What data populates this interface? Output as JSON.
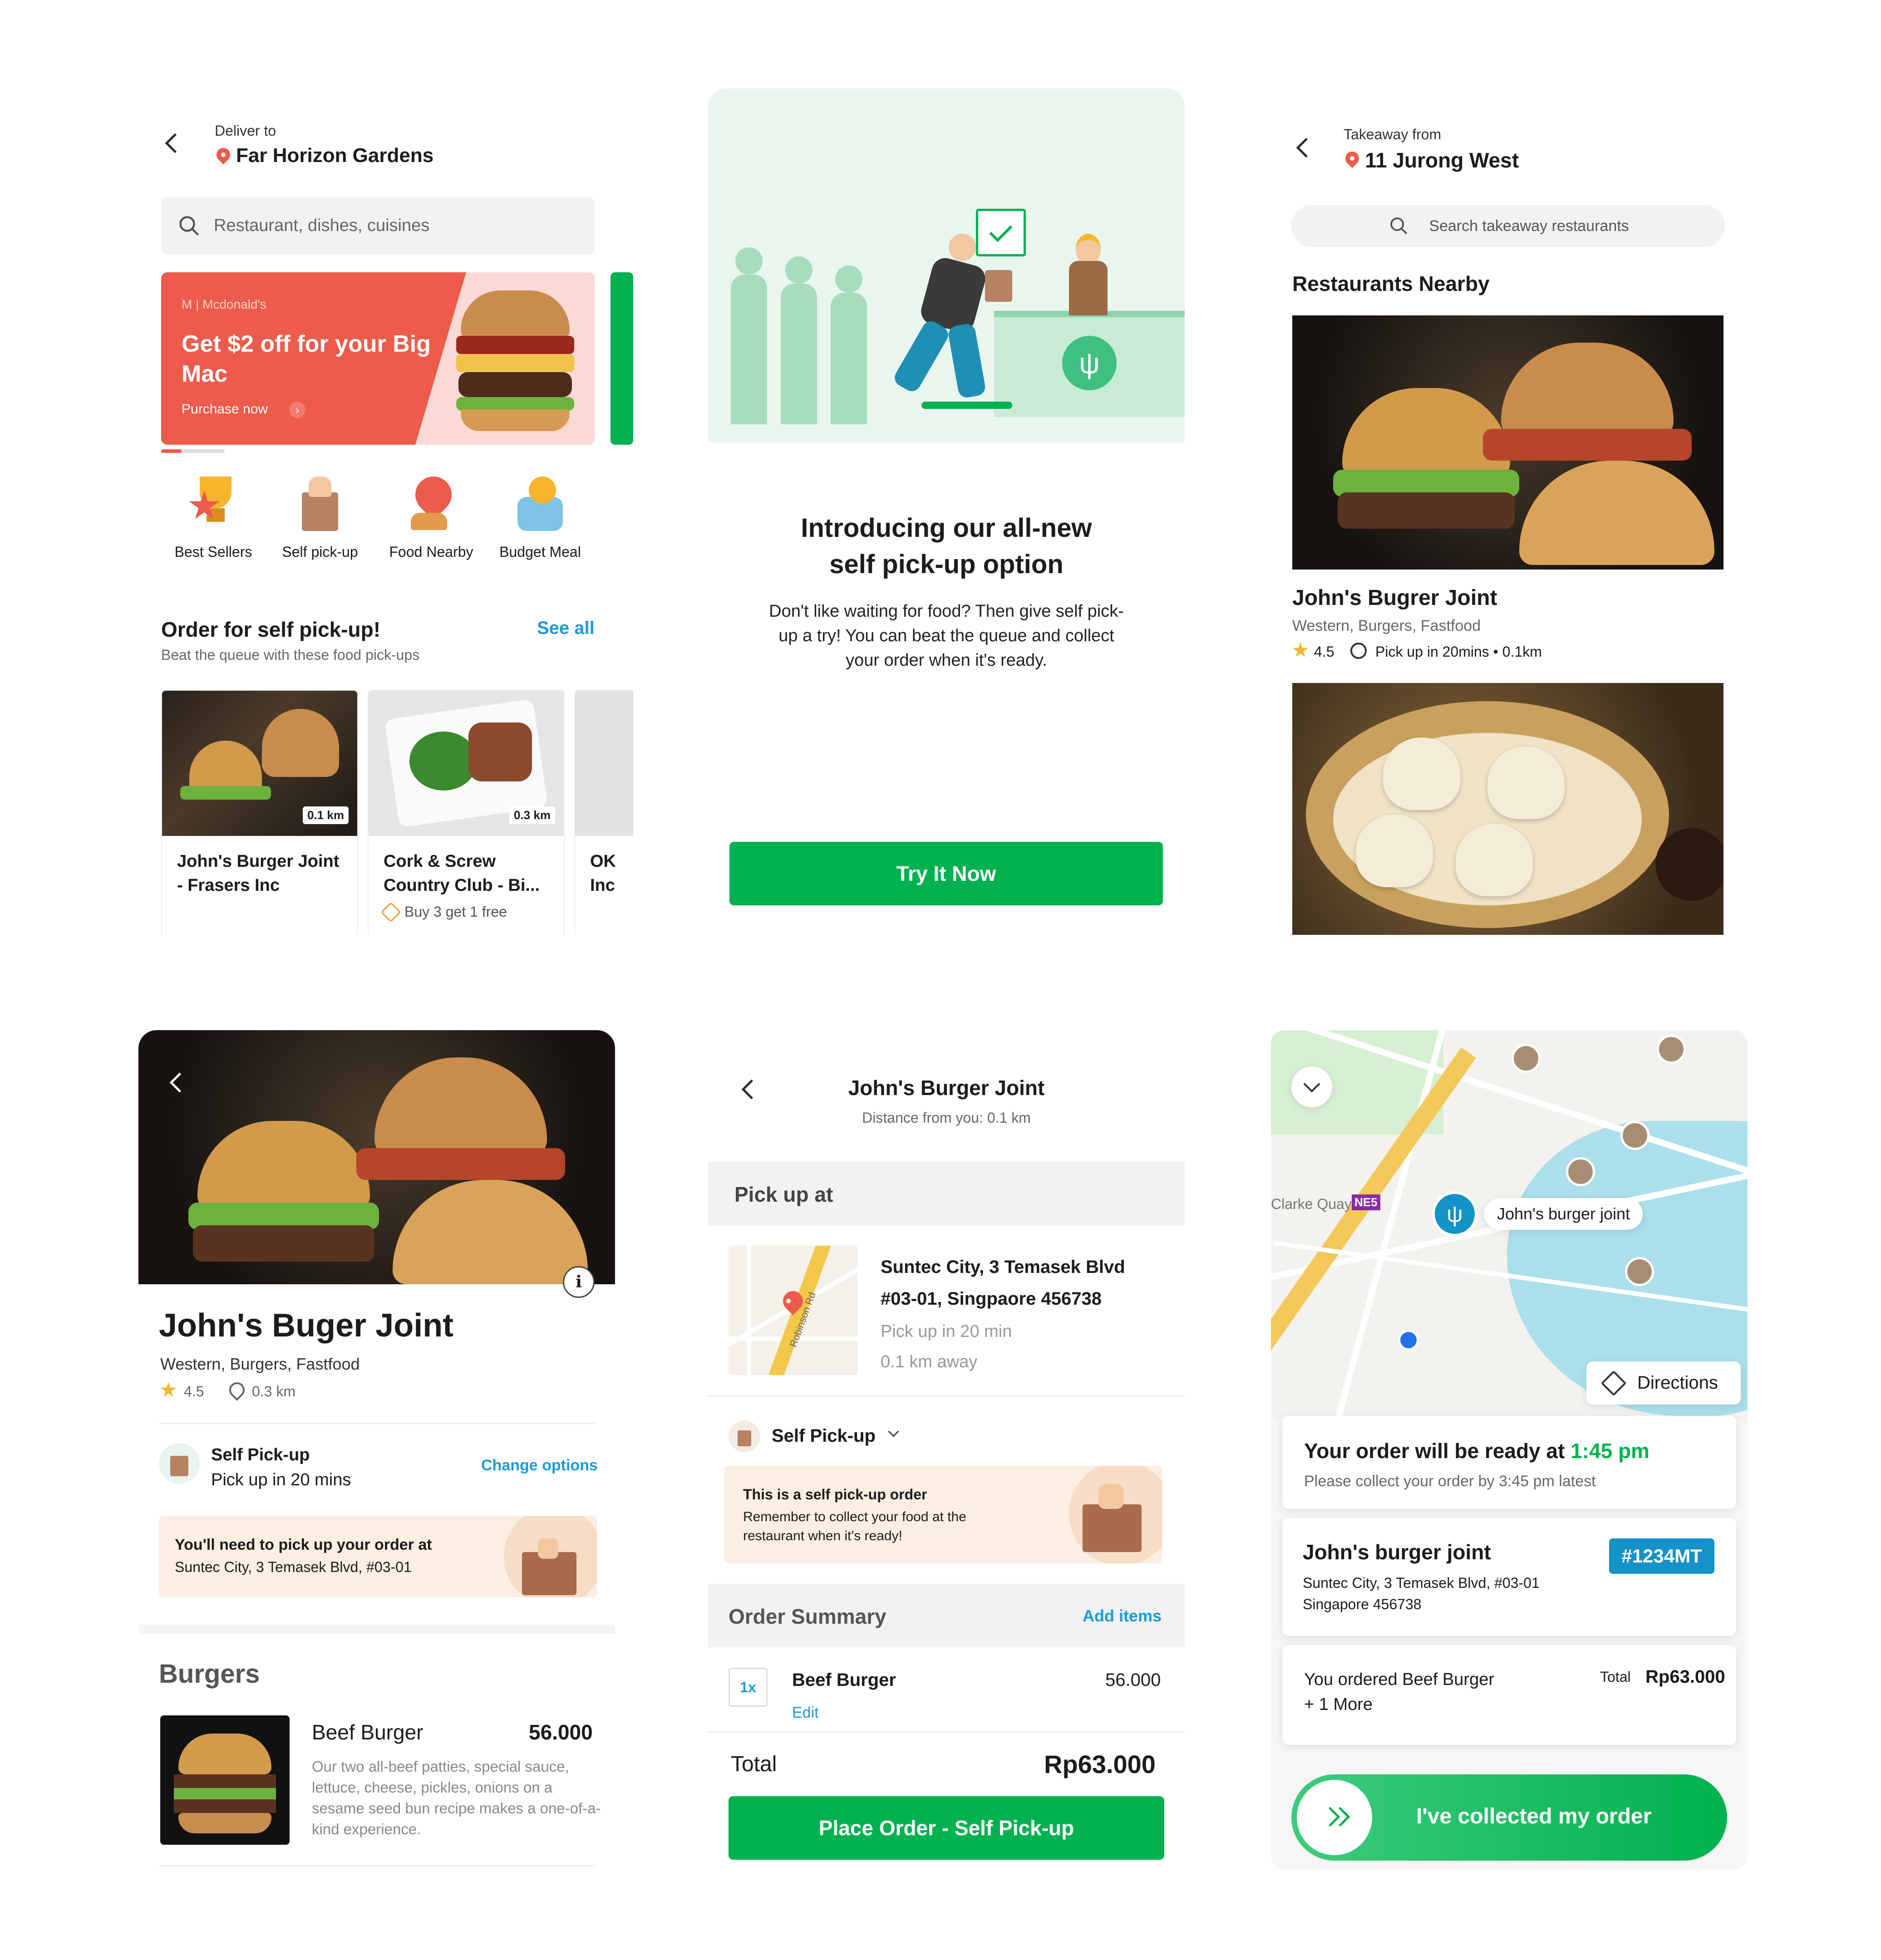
{
  "s1": {
    "deliver_label": "Deliver to",
    "address": "Far Horizon Gardens",
    "search_placeholder": "Restaurant, dishes, cuisines",
    "promo": {
      "brand": "M | Mcdonald's",
      "title": "Get $2 off for your Big Mac",
      "cta": "Purchase now"
    },
    "categories": [
      {
        "label": "Best Sellers",
        "icon": "trophy-icon"
      },
      {
        "label": "Self pick-up",
        "icon": "paper-bag-icon"
      },
      {
        "label": "Food Nearby",
        "icon": "location-pin-icon"
      },
      {
        "label": "Budget Meal",
        "icon": "piggy-bank-icon"
      }
    ],
    "section_title": "Order for self pick-up!",
    "see_all": "See all",
    "section_subtitle": "Beat the queue with these food pick-ups",
    "cards": [
      {
        "name_line1": "John's Burger Joint",
        "name_line2": "- Frasers Inc",
        "distance": "0.1 km",
        "promo": ""
      },
      {
        "name_line1": "Cork & Screw",
        "name_line2": "Country Club - Bi...",
        "distance": "0.3 km",
        "promo": "Buy 3 get 1 free"
      },
      {
        "name_line1": "OK",
        "name_line2": "Inc",
        "distance": "",
        "promo": ""
      }
    ]
  },
  "s2": {
    "title_line1": "Introducing our all-new",
    "title_line2": "self pick-up option",
    "body": "Don't like waiting for food? Then give self pick-up a try! You can beat the queue and collect your order when it's ready.",
    "button": "Try It Now"
  },
  "s3": {
    "takeaway_label": "Takeaway from",
    "address": "11 Jurong West",
    "search_placeholder": "Search takeaway restaurants",
    "section_title": "Restaurants Nearby",
    "restaurant": {
      "name": "John's Bugrer Joint",
      "cuisines": "Western, Burgers, Fastfood",
      "rating": "4.5",
      "pickup": "Pick up in 20mins • 0.1km"
    }
  },
  "s4": {
    "name": "John's Buger Joint",
    "cuisines": "Western, Burgers, Fastfood",
    "rating": "4.5",
    "distance": "0.3 km",
    "mode_title": "Self Pick-up",
    "mode_sub": "Pick up in 20 mins",
    "change": "Change options",
    "notice_line1": "You'll need to pick up your order at",
    "notice_line2": "Suntec City, 3 Temasek Blvd, #03-01",
    "section": "Burgers",
    "item": {
      "name": "Beef Burger",
      "price": "56.000",
      "desc": "Our two all-beef patties, special sauce, lettuce, cheese, pickles, onions on a sesame seed bun recipe makes a one-of-a-kind experience."
    }
  },
  "s5": {
    "title": "John's Burger Joint",
    "subtitle": "Distance from you: 0.1 km",
    "pickup_at": "Pick up at",
    "addr1": "Suntec City, 3 Temasek Blvd",
    "addr2": "#03-01, Singpaore 456738",
    "time": "Pick up in 20 min",
    "away": "0.1 km away",
    "road": "Robinson Rd",
    "mode": "Self Pick-up",
    "notice_title": "This is a self pick-up order",
    "notice_body": "Remember to collect your food at the restaurant when it's ready!",
    "summary": "Order Summary",
    "add_items": "Add items",
    "qty": "1x",
    "item": "Beef Burger",
    "item_price": "56.000",
    "edit": "Edit",
    "total_label": "Total",
    "total": "Rp63.000",
    "button": "Place Order - Self Pick-up"
  },
  "s6": {
    "station": "Clarke Quay",
    "station_code": "NE5",
    "marker_label": "John's burger joint",
    "directions": "Directions",
    "ready_prefix": "Your order will be ready at",
    "ready_time": "1:45 pm",
    "collect_note": "Please collect your order by 3:45 pm latest",
    "restaurant": "John's burger joint",
    "address1": "Suntec City, 3 Temasek Blvd, #03-01",
    "address2": "Singapore 456738",
    "order_id": "#1234MT",
    "ordered1": "You ordered Beef Burger",
    "ordered2": "+ 1 More",
    "total_label": "Total",
    "total": "Rp63.000",
    "slider": "I've collected my order"
  },
  "colors": {
    "brand_green": "#00b14f",
    "promo_red": "#ec5b4b",
    "order_badge": "#1592c8",
    "notice_bg": "#fbeee2"
  }
}
